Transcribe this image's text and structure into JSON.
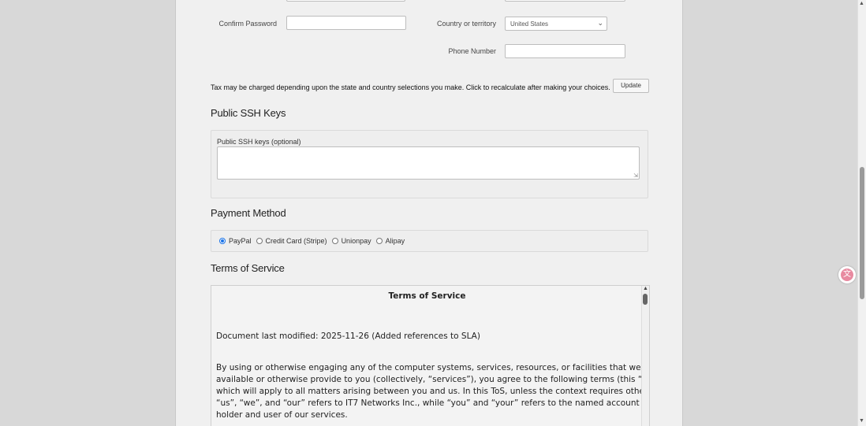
{
  "form": {
    "confirm_password_label": "Confirm Password",
    "country_label": "Country or territory",
    "country_value": "United States",
    "phone_label": "Phone Number",
    "tax_note": "Tax may be charged depending upon the state and country selections you make. Click to recalculate after making your choices.",
    "update_label": "Update"
  },
  "ssh": {
    "heading": "Public SSH Keys",
    "field_label": "Public SSH keys (optional)"
  },
  "payment": {
    "heading": "Payment Method",
    "options": [
      "PayPal",
      "Credit Card (Stripe)",
      "Unionpay",
      "Alipay"
    ],
    "selected": "PayPal"
  },
  "tos": {
    "heading": "Terms of Service",
    "box_title": "Terms of Service",
    "modified": "Document last modified: 2025-11-26 (Added references to SLA)",
    "para_lines": [
      "By using or otherwise engaging any of the computer systems, services, resources, or facilities that we make",
      "available or otherwise provide to you (collectively, “services”), you agree to the following terms (this “ToS”),",
      "which will apply to all matters arising between you and us. In this ToS, unless the context requires otherwise,",
      "“us”, “we”, and “our” refers to IT7 Networks Inc., while “you” and “your” refers to the named account",
      "holder and user of our services."
    ]
  },
  "colors": {
    "accent": "#1a73e8",
    "page_bg": "#f0f0f0",
    "outer_bg": "#d8d8d8"
  }
}
